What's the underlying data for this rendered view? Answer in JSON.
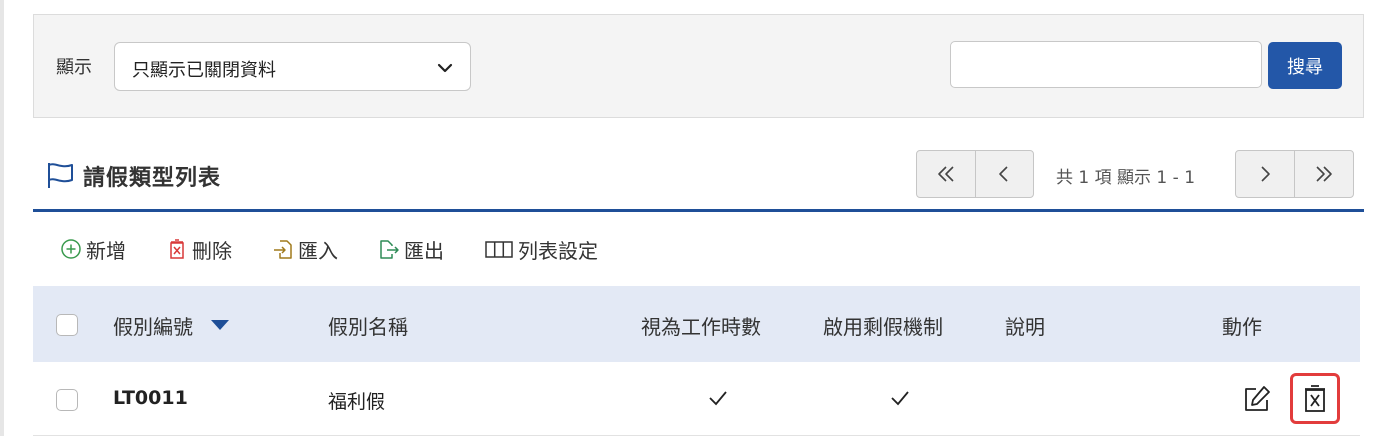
{
  "filter": {
    "label": "顯示",
    "selected": "只顯示已關閉資料",
    "search_value": "",
    "search_button": "搜尋"
  },
  "header": {
    "title": "請假類型列表"
  },
  "pager": {
    "info": "共 1 項 顯示 1 - 1"
  },
  "toolbar": {
    "add": "新增",
    "delete": "刪除",
    "import": "匯入",
    "export": "匯出",
    "list_settings": "列表設定"
  },
  "table": {
    "columns": [
      "假別編號",
      "假別名稱",
      "視為工作時數",
      "啟用剩假機制",
      "說明",
      "動作"
    ],
    "rows": [
      {
        "code": "LT0011",
        "name": "福利假",
        "count_as_work_hours": true,
        "leftover_enabled": true,
        "description": ""
      }
    ]
  },
  "colors": {
    "primary": "#2357a8",
    "header_bg": "#e3e9f5",
    "danger": "#e23c3c",
    "add_icon": "#3a9a4e",
    "import_icon": "#a07a1c",
    "export_icon": "#2e8b57"
  },
  "icons": [
    "chevron-down-icon",
    "flag-icon",
    "first-page-icon",
    "prev-page-icon",
    "next-page-icon",
    "last-page-icon",
    "plus-circle-icon",
    "trash-x-icon",
    "import-icon",
    "export-icon",
    "columns-icon",
    "sort-desc-icon",
    "check-icon",
    "edit-icon",
    "delete-icon"
  ]
}
